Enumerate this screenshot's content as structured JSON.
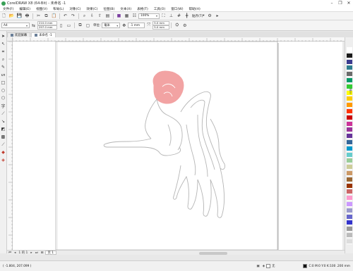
{
  "window": {
    "title": "CorelDRAW X8 (64-Bit) - 未命名 -1",
    "controls": [
      "–",
      "❐",
      "✕"
    ]
  },
  "menu": [
    "文件(F)",
    "编辑(E)",
    "视图(V)",
    "布局(L)",
    "对象(C)",
    "效果(C)",
    "位图(B)",
    "文本(X)",
    "表格(T)",
    "工具(O)",
    "窗口(W)",
    "帮助(H)"
  ],
  "toolbar": {
    "zoom": "100%",
    "snap_label": "贴齐(T)"
  },
  "property_bar": {
    "page_size": "A4",
    "width": "210.0 mm",
    "height": "297.0 mm",
    "units_label": "单位:",
    "units": "毫米",
    "nudge": ".1 mm",
    "dup_x": "5.0 mm",
    "dup_y": "5.0 mm"
  },
  "doc_tabs": [
    "欢迎屏幕",
    "未命名 -1"
  ],
  "palette_colors": [
    "#ffffff",
    "#1a1a1a",
    "#3b3b8f",
    "#2e7d8f",
    "#6b6b6b",
    "#009966",
    "#33cc33",
    "#ffff00",
    "#ffcc00",
    "#ff9900",
    "#ff3300",
    "#cc0000",
    "#cc3399",
    "#993399",
    "#663399",
    "#336699",
    "#0099cc",
    "#66cccc",
    "#99cc99",
    "#cccc99",
    "#cc9966",
    "#996633",
    "#993300",
    "#cc6666",
    "#ff99cc",
    "#cc99ff",
    "#9999cc",
    "#6666cc",
    "#3333cc",
    "#999999",
    "#bbbbbb",
    "#dddddd"
  ],
  "docker_tab": "提示",
  "page_bar": {
    "pages": "1 的 1",
    "page_tab": "页 1"
  },
  "status": {
    "coords": "( -1.804, 207.099 )",
    "fill_label": "无",
    "color_info": "C:0 M:0 Y:0 K:100  .200 mm"
  },
  "drawing": {
    "head_color": "#f2a3a3",
    "line_color": "#b5b5b5"
  }
}
